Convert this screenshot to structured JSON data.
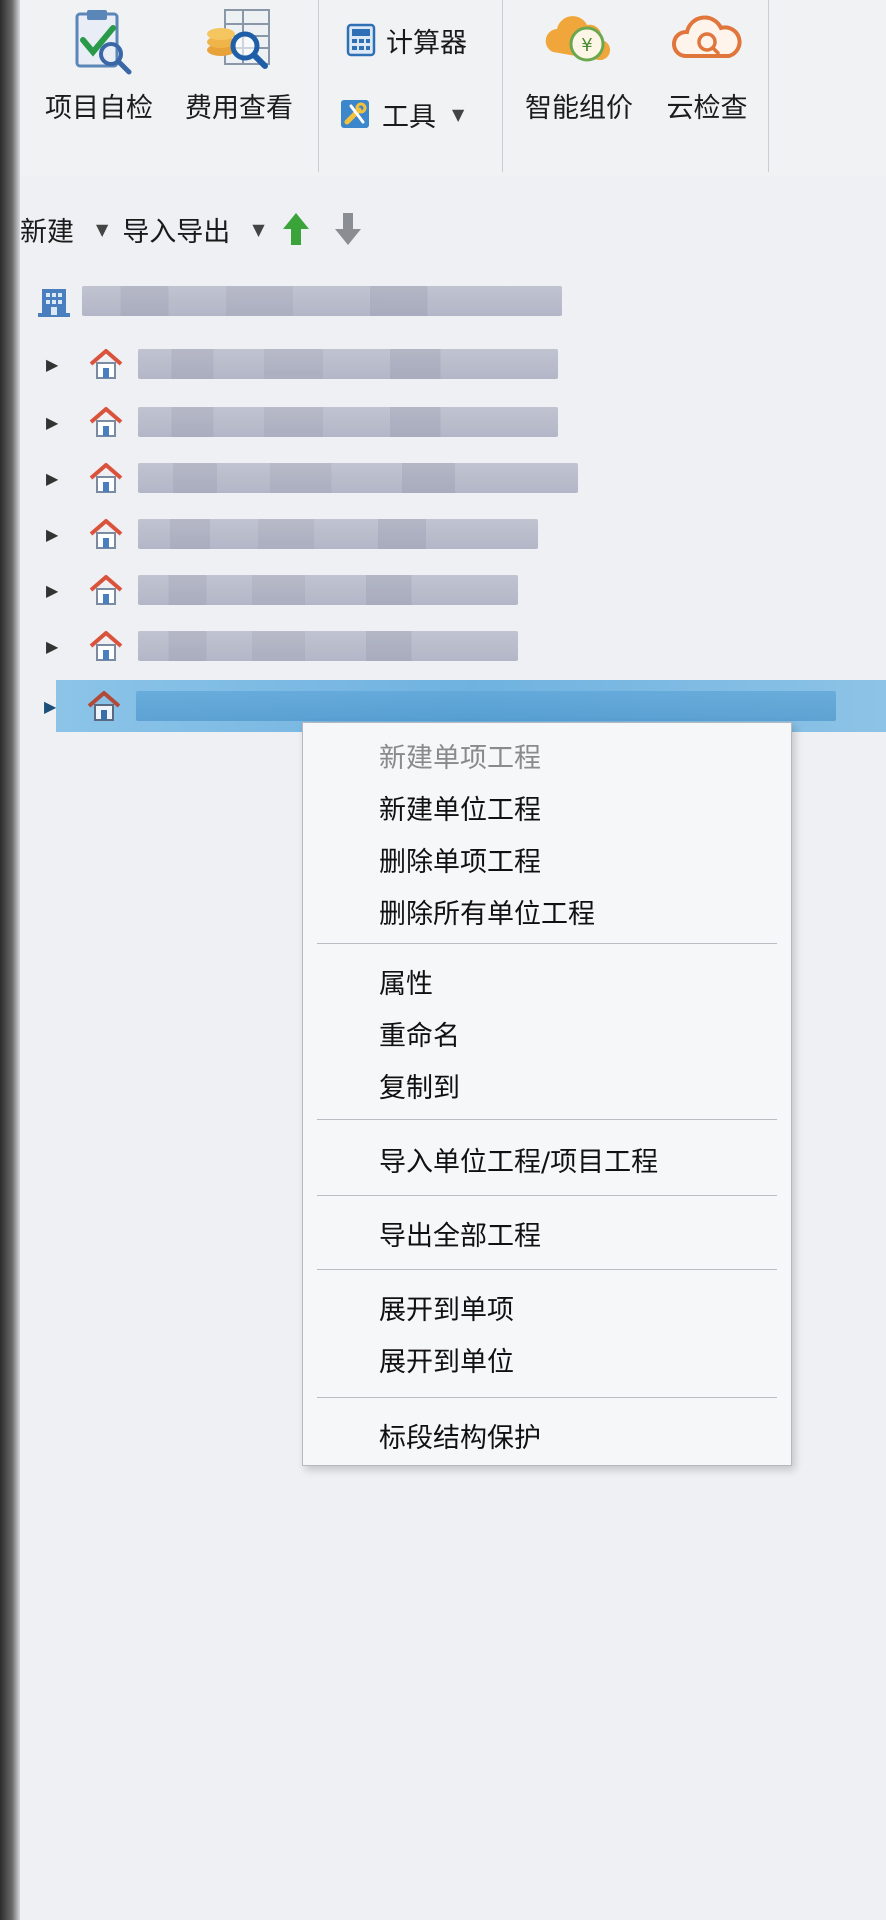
{
  "ribbon": {
    "self_check": {
      "label": "项目自检",
      "icon": "clipboard-check-icon"
    },
    "cost_view": {
      "label": "费用查看",
      "icon": "spreadsheet-magnifier-icon"
    },
    "calculator": {
      "label": "计算器",
      "icon": "calculator-icon"
    },
    "tools": {
      "label": "工具",
      "icon": "tools-icon"
    },
    "smart_pricing": {
      "label": "智能组价",
      "icon": "coins-cloud-icon"
    },
    "cloud_check": {
      "label": "云检查",
      "icon": "cloud-search-icon"
    }
  },
  "toolbar": {
    "new_label": "新建",
    "import_export_label": "导入导出",
    "move_up_icon": "arrow-up-green-icon",
    "move_down_icon": "arrow-down-gray-icon"
  },
  "tree": {
    "root_icon": "building-icon",
    "item_icon": "house-icon",
    "item_count": 7,
    "selected_index": 6
  },
  "context_menu": {
    "items": [
      {
        "label": "新建单项工程",
        "disabled": true
      },
      {
        "label": "新建单位工程"
      },
      {
        "label": "删除单项工程"
      },
      {
        "label": "删除所有单位工程"
      },
      {
        "label": "属性"
      },
      {
        "label": "重命名"
      },
      {
        "label": "复制到"
      },
      {
        "label": "导入单位工程/项目工程"
      },
      {
        "label": "导出全部工程"
      },
      {
        "label": "展开到单项"
      },
      {
        "label": "展开到单位"
      },
      {
        "label": "标段结构保护"
      }
    ]
  },
  "colors": {
    "selection": "#7fbbe5",
    "house_roof": "#d9533c",
    "accent_blue": "#2f7fc1",
    "up_arrow": "#3aa33a"
  }
}
